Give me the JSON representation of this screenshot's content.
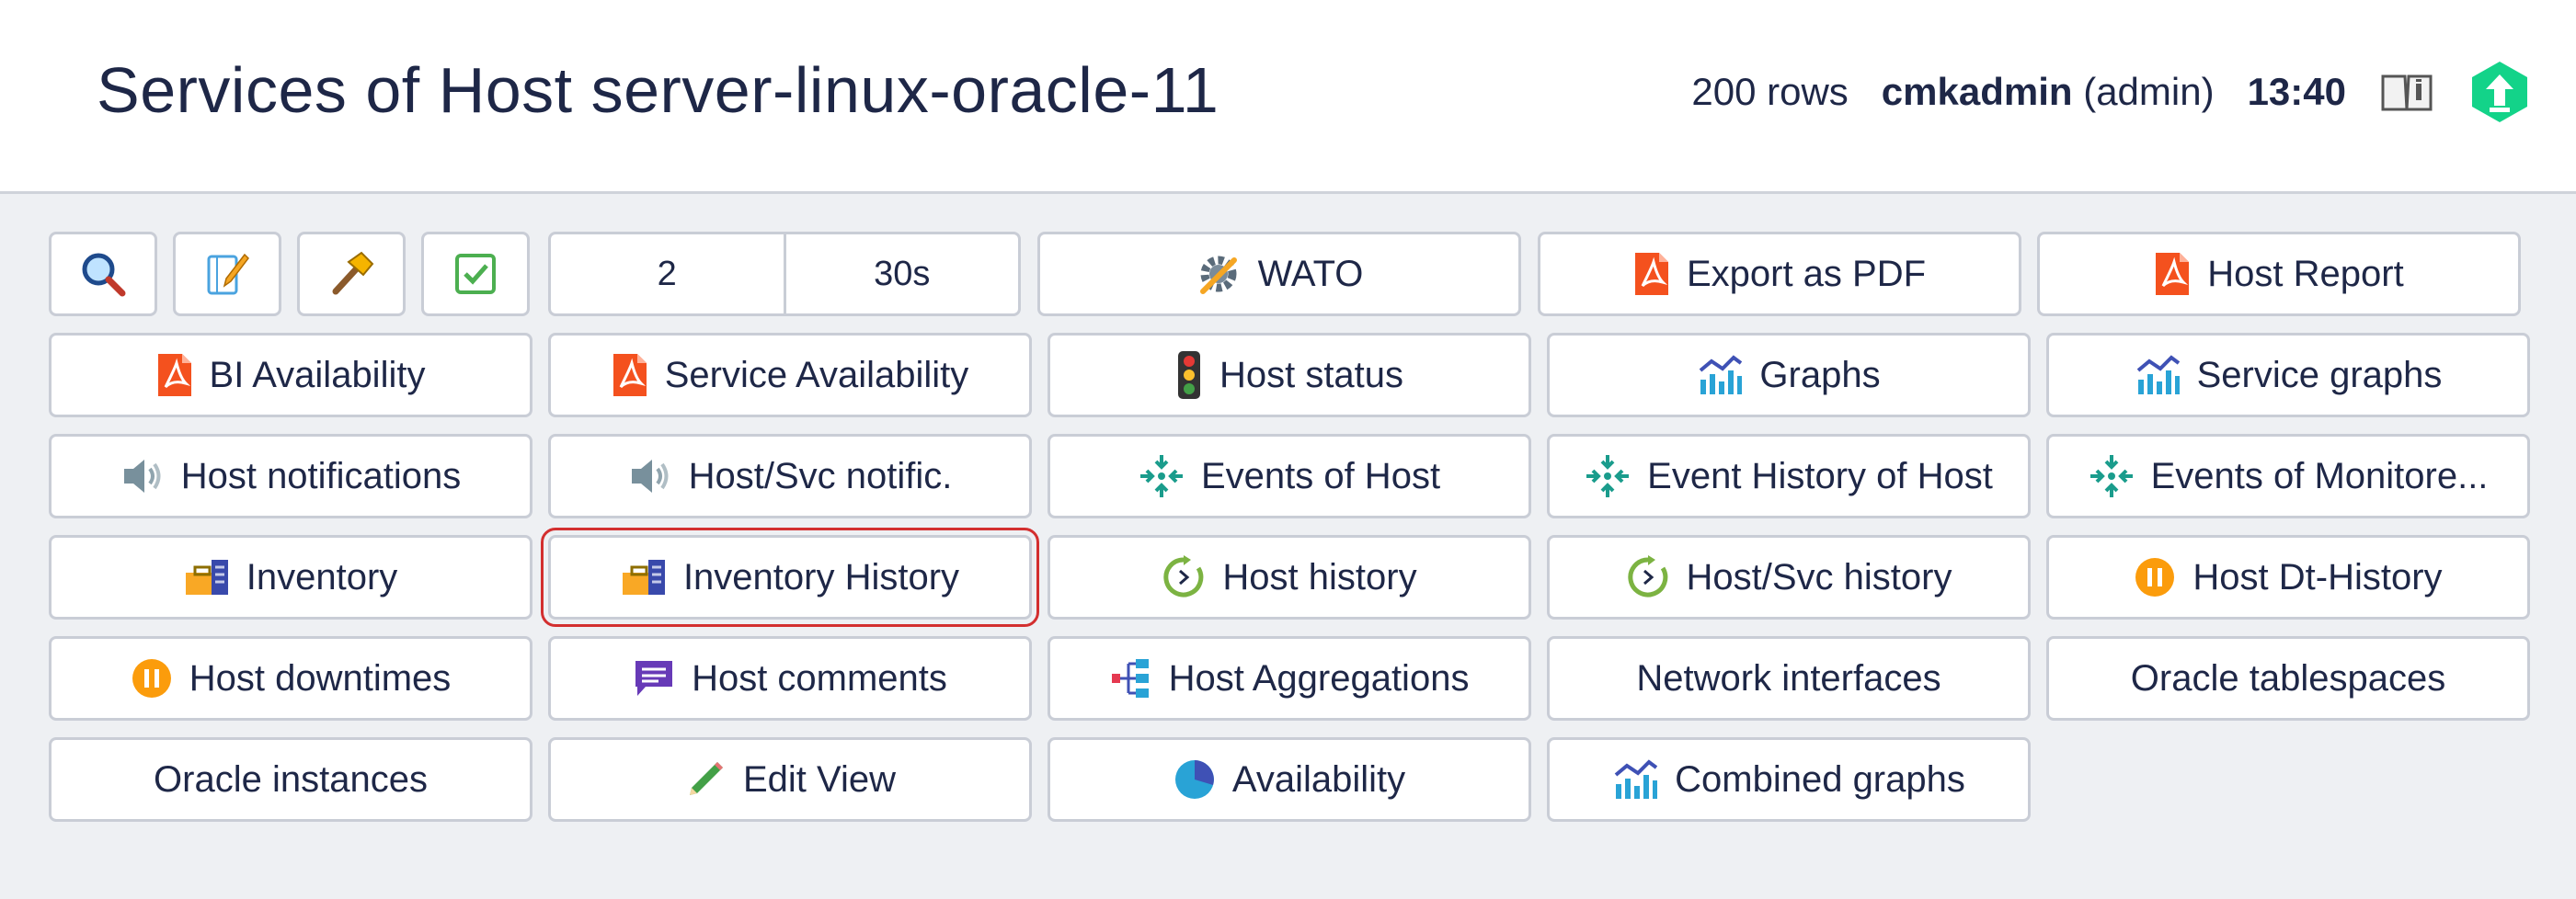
{
  "header": {
    "title": "Services of Host server-linux-oracle-11",
    "rows": "200 rows",
    "user": "cmkadmin",
    "role": "(admin)",
    "time": "13:40"
  },
  "icon_buttons": [
    {
      "name": "search-icon",
      "label": "Search"
    },
    {
      "name": "edit-icon",
      "label": "Edit"
    },
    {
      "name": "hammer-icon",
      "label": "Commands"
    },
    {
      "name": "checkbox-icon",
      "label": "Checkboxes"
    }
  ],
  "refresh": {
    "count": "2",
    "interval": "30s"
  },
  "buttons": {
    "wato": "WATO",
    "export_pdf": "Export as PDF",
    "host_report": "Host Report",
    "bi_availability": "BI Availability",
    "service_availability": "Service Availability",
    "host_status": "Host status",
    "graphs": "Graphs",
    "service_graphs": "Service graphs",
    "host_notifications": "Host notifications",
    "host_svc_notific": "Host/Svc notific.",
    "events_of_host": "Events of Host",
    "event_history_of_host": "Event History of Host",
    "events_of_monitored": "Events of Monitore...",
    "inventory": "Inventory",
    "inventory_history": "Inventory History",
    "host_history": "Host history",
    "host_svc_history": "Host/Svc history",
    "host_dt_history": "Host Dt-History",
    "host_downtimes": "Host downtimes",
    "host_comments": "Host comments",
    "host_aggregations": "Host Aggregations",
    "network_interfaces": "Network interfaces",
    "oracle_tablespaces": "Oracle tablespaces",
    "oracle_instances": "Oracle instances",
    "edit_view": "Edit View",
    "availability": "Availability",
    "combined_graphs": "Combined graphs"
  },
  "colors": {
    "accent_green": "#13d389",
    "pdf_red": "#f4511e",
    "event_teal": "#1a9c8c",
    "history_green": "#7cb342",
    "downtime_orange": "#fb9c0c",
    "comment_purple": "#673ab7",
    "highlight_border": "#d32f2f"
  }
}
